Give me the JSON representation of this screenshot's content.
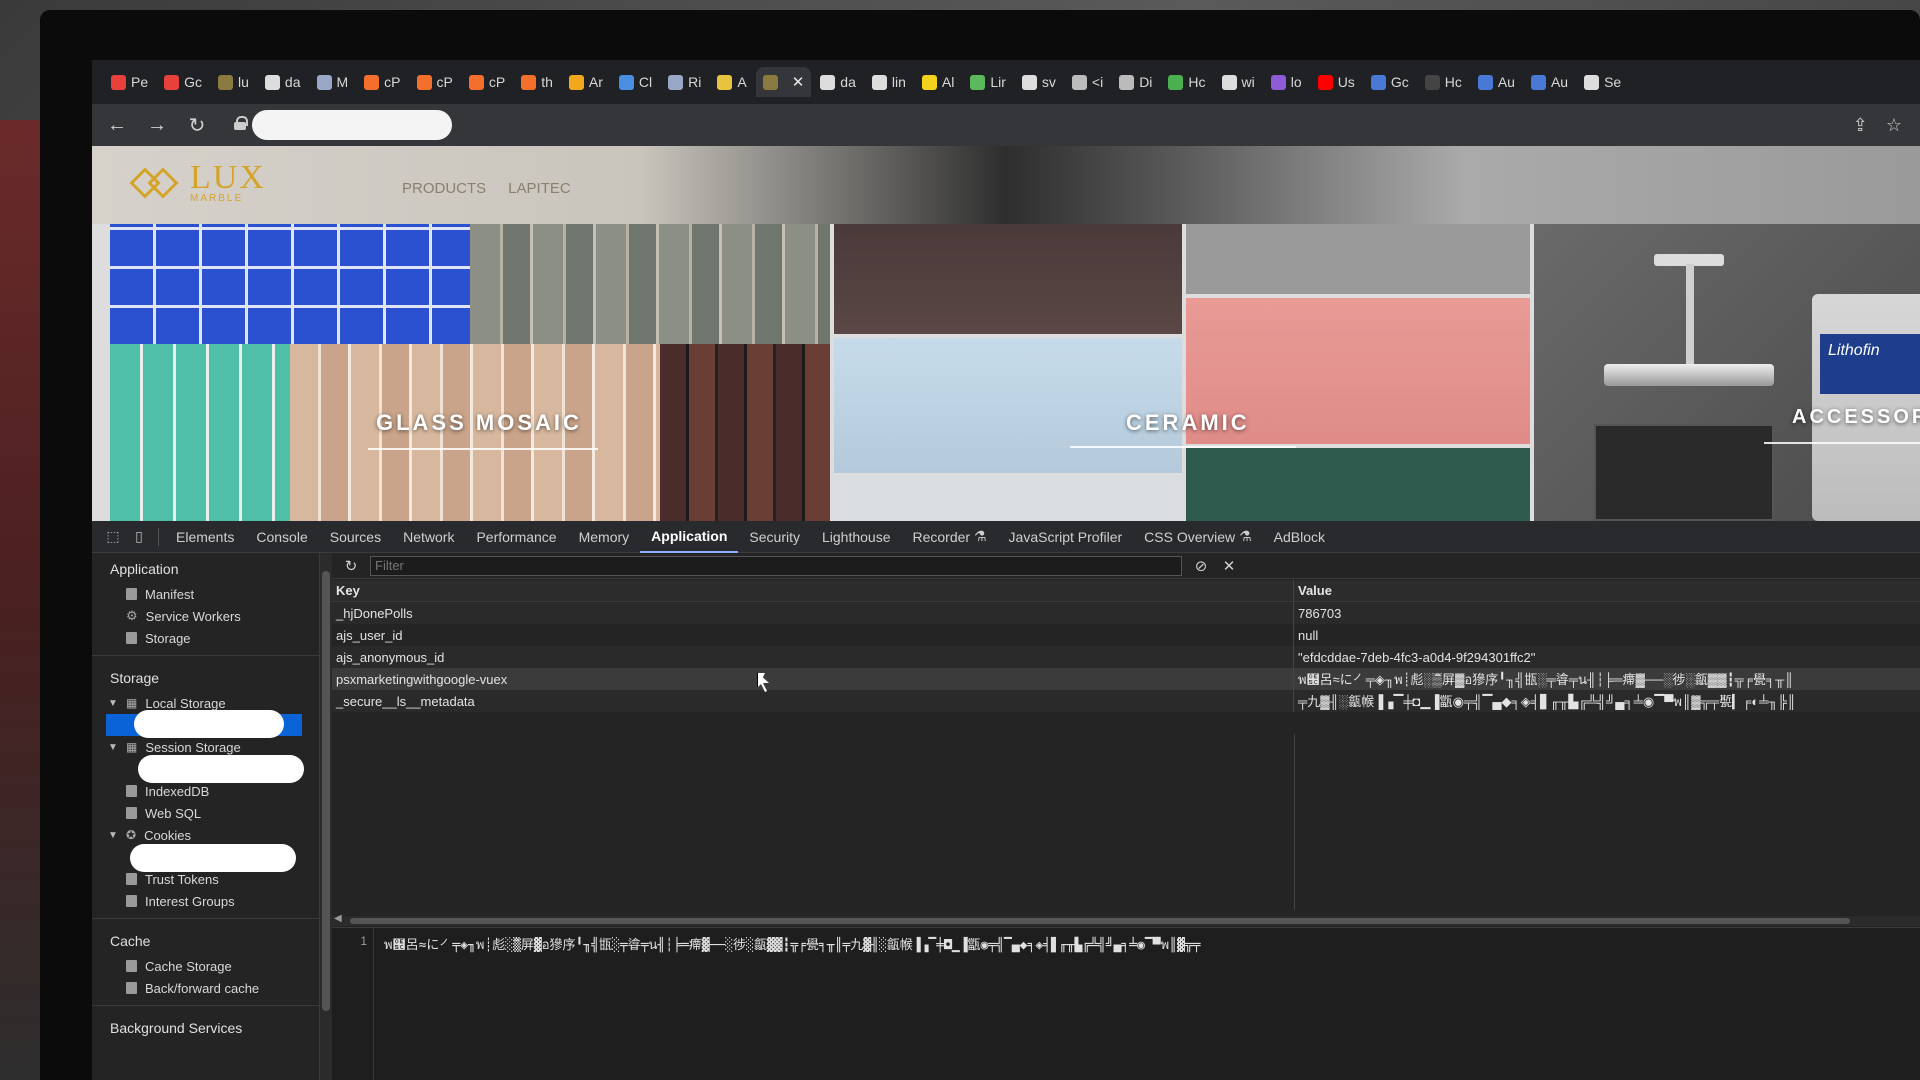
{
  "tabs": [
    {
      "label": "Pe",
      "color": "#e8413c"
    },
    {
      "label": "Gc",
      "color": "#e8413c"
    },
    {
      "label": "lu",
      "color": "#8a7a40"
    },
    {
      "label": "da",
      "color": "#dddddd"
    },
    {
      "label": "M",
      "color": "#9aa8c8"
    },
    {
      "label": "cP",
      "color": "#f36f2b"
    },
    {
      "label": "cP",
      "color": "#f36f2b"
    },
    {
      "label": "cP",
      "color": "#f36f2b"
    },
    {
      "label": "th",
      "color": "#f36f2b"
    },
    {
      "label": "Ar",
      "color": "#f2a81d"
    },
    {
      "label": "Cl",
      "color": "#4a90e2"
    },
    {
      "label": "Ri",
      "color": "#9aa8c8"
    },
    {
      "label": "A",
      "color": "#e6c440"
    },
    {
      "label": "",
      "color": "#8a7a40",
      "active": true
    },
    {
      "label": "da",
      "color": "#dddddd"
    },
    {
      "label": "lin",
      "color": "#dddddd"
    },
    {
      "label": "Al",
      "color": "#f2d21d"
    },
    {
      "label": "Lir",
      "color": "#5cb85c"
    },
    {
      "label": "sv",
      "color": "#dddddd"
    },
    {
      "label": "<i",
      "color": "#bbbbbb"
    },
    {
      "label": "Di",
      "color": "#bbbbbb"
    },
    {
      "label": "Hc",
      "color": "#4caf50"
    },
    {
      "label": "wi",
      "color": "#dddddd"
    },
    {
      "label": "lo",
      "color": "#8e5bd6"
    },
    {
      "label": "Us",
      "color": "#ff0000"
    },
    {
      "label": "Gc",
      "color": "#4a78d6"
    },
    {
      "label": "Hc",
      "color": "#444444"
    },
    {
      "label": "Au",
      "color": "#4a78d6"
    },
    {
      "label": "Au",
      "color": "#4a78d6"
    },
    {
      "label": "Se",
      "color": "#dddddd"
    }
  ],
  "site": {
    "logo_text": "LUX",
    "logo_sub": "MARBLE",
    "nav": [
      "PRODUCTS",
      "LAPITEC"
    ],
    "panels": {
      "glass": "GLASS MOSAIC",
      "ceramic": "CERAMIC",
      "accessories": "ACCESSORIE",
      "can_label": "Lithofin"
    }
  },
  "devtools": {
    "tabs": [
      "Elements",
      "Console",
      "Sources",
      "Network",
      "Performance",
      "Memory",
      "Application",
      "Security",
      "Lighthouse",
      "Recorder",
      "JavaScript Profiler",
      "CSS Overview",
      "AdBlock"
    ],
    "active_tab": "Application",
    "sidebar": {
      "application_header": "Application",
      "application_items": [
        "Manifest",
        "Service Workers",
        "Storage"
      ],
      "storage_header": "Storage",
      "local_storage": "Local Storage",
      "session_storage": "Session Storage",
      "indexeddb": "IndexedDB",
      "web_sql": "Web SQL",
      "cookies": "Cookies",
      "trust_tokens": "Trust Tokens",
      "interest_groups": "Interest Groups",
      "cache_header": "Cache",
      "cache_storage": "Cache Storage",
      "back_forward_cache": "Back/forward cache",
      "background_header": "Background Services"
    },
    "filter_placeholder": "Filter",
    "columns": {
      "key": "Key",
      "value": "Value"
    },
    "rows": [
      {
        "key": "_hjDonePolls",
        "value": "786703"
      },
      {
        "key": "ajs_user_id",
        "value": "null"
      },
      {
        "key": "ajs_anonymous_id",
        "value": "\"efdcddae-7deb-4fc3-a0d4-9f294301ffc2\""
      },
      {
        "key": "psxmarketingwithgoogle-vuex",
        "value": "พ๜呂≈に㇒╤◈╖พ┊彪░▒ิ屏▓อ㺑序╹╖╣㽍░╤㽏╤น╢┆╞═㿃▓──░徏░㽂▓▓┇╦╒㽇╕╥║",
        "hover": true
      },
      {
        "key": "_secure__ls__metadata",
        "value": "╤九▓╢░㽂帿▐▗▔╪◘▁▐㽆◉╤╣▔▄◆╕◈╡▋╓╥▙╔╩╣╝▄╕╧◉▔▀พ║▓╦╤㽄▎╒◐╧╖╠║"
      }
    ],
    "preview_line_no": "1",
    "preview_code": "พ๜呂≈に㇒╤◈╖พ┊彪░▒ิ屏▓อ㺑序╹╖╣㽍░╤㽏╤น╢┆╞═㿃▓──░徏░㽂▓▓┇╦╒㽇╕╥║╤九▓╢░㽂帿▐▗▔╪◘▁▐㽆◉╤╣▔▄◆╕◈╡▋╓╥▙╔╩╣╝▄╕╧◉▔▀พ║▓╦╤"
  }
}
